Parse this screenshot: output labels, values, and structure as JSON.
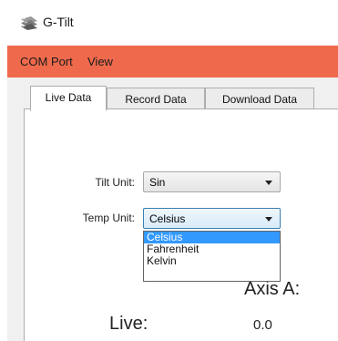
{
  "window": {
    "title": "G-Tilt",
    "app_icon": "ruler-stack-icon"
  },
  "menu": {
    "items": [
      "COM Port",
      "View"
    ]
  },
  "tabs": [
    {
      "label": "Live Data",
      "active": true
    },
    {
      "label": "Record Data",
      "active": false
    },
    {
      "label": "Download Data",
      "active": false
    }
  ],
  "live_data": {
    "tilt_unit": {
      "label": "Tilt Unit:",
      "value": "Sin"
    },
    "temp_unit": {
      "label": "Temp Unit:",
      "value": "Celsius"
    },
    "temp_dropdown": {
      "options": [
        "Celsius",
        "Fahrenheit",
        "Kelvin"
      ],
      "selected": "Celsius"
    },
    "axis_title": "Axis A:",
    "live_label": "Live:",
    "live_value": "0.0"
  },
  "colors": {
    "menubar": "#ef6a4c",
    "selection": "#3399ff"
  }
}
